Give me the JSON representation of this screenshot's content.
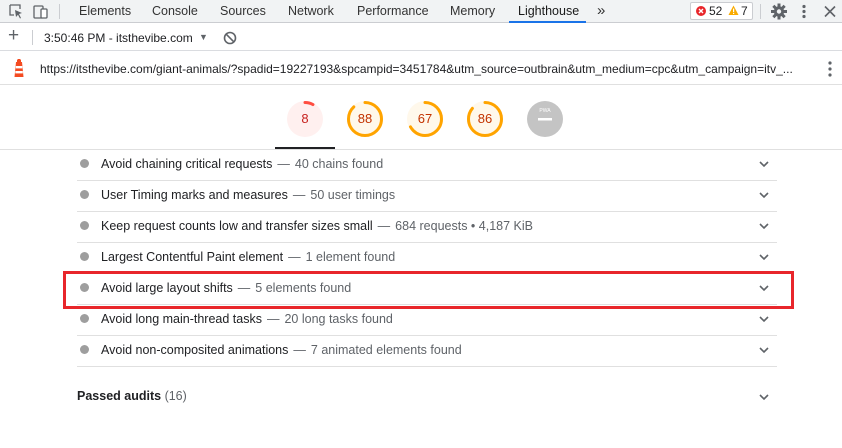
{
  "devtools": {
    "tabs": [
      "Elements",
      "Console",
      "Sources",
      "Network",
      "Performance",
      "Memory",
      "Lighthouse"
    ],
    "active_tab": "Lighthouse",
    "overflow_label": "»",
    "errors_count": "52",
    "warnings_count": "7"
  },
  "report_bar": {
    "add_label": "+",
    "report_selector": "3:50:46 PM - itsthevibe.com",
    "dropdown_label": "▼"
  },
  "page": {
    "url": "https://itsthevibe.com/giant-animals/?spadid=19227193&spcampid=3451784&utm_source=outbrain&utm_medium=cpc&utm_campaign=itv_..."
  },
  "scores": [
    {
      "label": "8",
      "value": 8,
      "color": "#ff4e42"
    },
    {
      "label": "88",
      "value": 88,
      "color": "#ffa400"
    },
    {
      "label": "67",
      "value": 67,
      "color": "#ffa400"
    },
    {
      "label": "86",
      "value": 86,
      "color": "#ffa400"
    },
    {
      "label": "PWA",
      "value": null,
      "color": "#bdbdbd"
    }
  ],
  "audits": [
    {
      "title": "Avoid chaining critical requests",
      "detail": "40 chains found"
    },
    {
      "title": "User Timing marks and measures",
      "detail": "50 user timings"
    },
    {
      "title": "Keep request counts low and transfer sizes small",
      "detail": "684 requests • 4,187 KiB"
    },
    {
      "title": "Largest Contentful Paint element",
      "detail": "1 element found"
    },
    {
      "title": "Avoid large layout shifts",
      "detail": "5 elements found"
    },
    {
      "title": "Avoid long main-thread tasks",
      "detail": "20 long tasks found"
    },
    {
      "title": "Avoid non-composited animations",
      "detail": "7 animated elements found"
    }
  ],
  "dash": "—",
  "passed_audits": {
    "label": "Passed audits",
    "count": "(16)"
  },
  "colors": {
    "highlight": "#e8262b",
    "active_tab": "#1a73e8",
    "error": "#e8262b",
    "warning": "#f9ab00"
  }
}
